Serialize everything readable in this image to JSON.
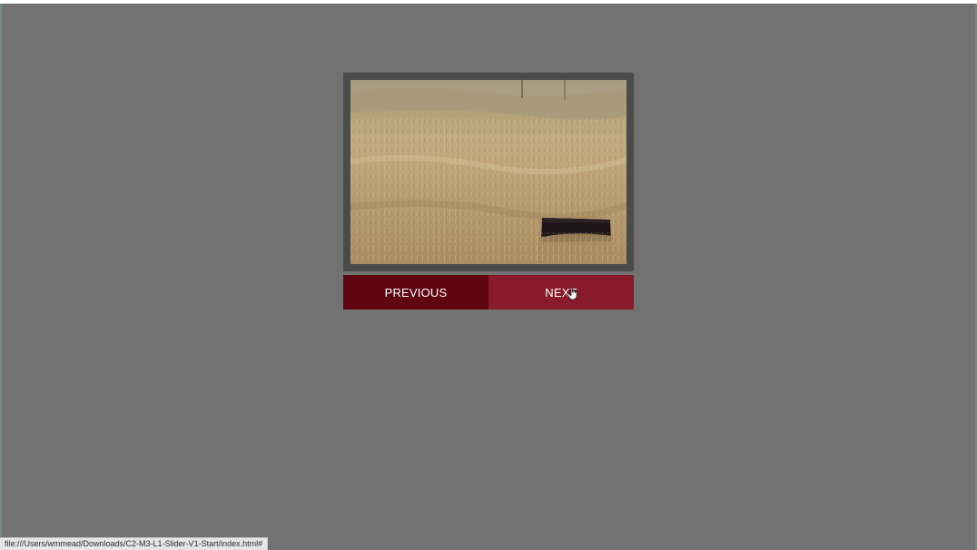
{
  "page": {
    "background_color": "#727272"
  },
  "slider": {
    "frame_color": "#4a4c4b",
    "image_description_name": "grassland-photo",
    "prev_label": "PREVIOUS",
    "next_label": "NEXT",
    "prev_color": "#5e0510",
    "next_color": "#891a29"
  },
  "status_bar": {
    "url": "file:///Users/wmmead/Downloads/C2-M3-L1-Slider-V1-Start/index.html#"
  },
  "cursor": {
    "icon": "hand-pointer-icon"
  }
}
